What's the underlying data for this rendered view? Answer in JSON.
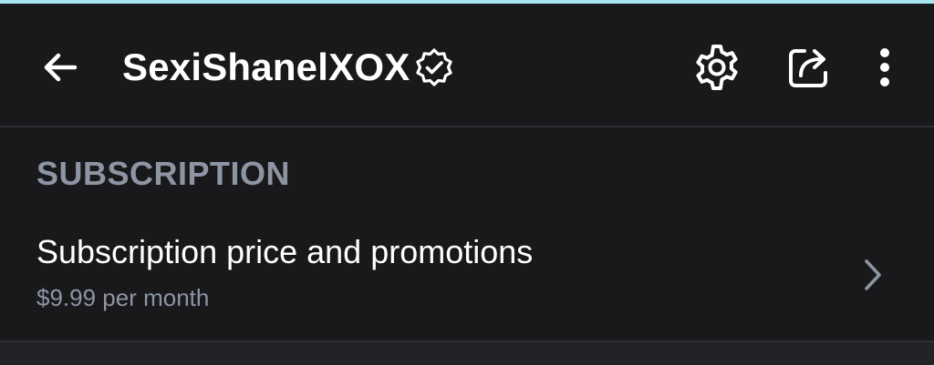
{
  "header": {
    "title": "SexiShanelXOX",
    "back_icon": "arrow-left-icon",
    "verified_icon": "verified-badge-icon",
    "actions": [
      {
        "icon": "gear-icon"
      },
      {
        "icon": "share-icon"
      },
      {
        "icon": "more-vertical-icon"
      }
    ]
  },
  "subscription": {
    "section_title": "SUBSCRIPTION",
    "row": {
      "title": "Subscription price and promotions",
      "subtitle": "$9.99 per month",
      "chevron_icon": "chevron-right-icon"
    }
  },
  "colors": {
    "background": "#19191c",
    "accent_strip": "#a6e6f0",
    "muted_text": "#8d95a3",
    "divider": "#2e2f33"
  }
}
